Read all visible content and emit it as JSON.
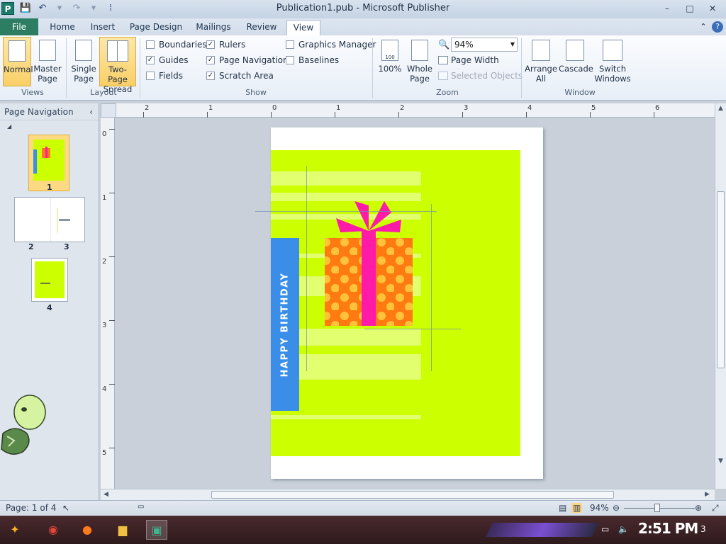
{
  "window": {
    "title": "Publication1.pub - Microsoft Publisher",
    "app_icon_letter": "P",
    "controls": {
      "minimize": "–",
      "maximize": "□",
      "close": "✕"
    }
  },
  "tabs": [
    {
      "label": "File"
    },
    {
      "label": "Home"
    },
    {
      "label": "Insert"
    },
    {
      "label": "Page Design"
    },
    {
      "label": "Mailings"
    },
    {
      "label": "Review"
    },
    {
      "label": "View",
      "active": true
    }
  ],
  "ribbon": {
    "views": {
      "label": "Views",
      "normal": "Normal",
      "master": "Master Page"
    },
    "layout": {
      "label": "Layout",
      "single": "Single Page",
      "two_page": "Two-Page Spread"
    },
    "show": {
      "label": "Show",
      "boundaries": {
        "label": "Boundaries",
        "checked": false
      },
      "guides": {
        "label": "Guides",
        "checked": true
      },
      "fields": {
        "label": "Fields",
        "checked": false
      },
      "rulers": {
        "label": "Rulers",
        "checked": true
      },
      "page_navigation": {
        "label": "Page Navigation",
        "checked": true
      },
      "scratch_area": {
        "label": "Scratch Area",
        "checked": true
      },
      "graphics_manager": {
        "label": "Graphics Manager",
        "checked": false
      },
      "baselines": {
        "label": "Baselines",
        "checked": false
      }
    },
    "zoom": {
      "label": "Zoom",
      "hundred": "100%",
      "whole_page": "Whole Page",
      "value": "94%",
      "page_width": "Page Width",
      "selected_objects": "Selected Objects",
      "hundred_icon_text": "100"
    },
    "window": {
      "label": "Window",
      "arrange_all": "Arrange All",
      "cascade": "Cascade",
      "switch_windows": "Switch Windows"
    }
  },
  "nav_pane": {
    "title": "Page Navigation",
    "collapse": "‹",
    "pages": [
      {
        "label": "1",
        "selected": true
      },
      {
        "label": "2"
      },
      {
        "label": "3"
      },
      {
        "label": "4"
      }
    ]
  },
  "rulers": {
    "horizontal": [
      "2",
      "1",
      "0",
      "1",
      "2",
      "3",
      "4",
      "5",
      "6"
    ],
    "vertical": [
      "0",
      "1",
      "2",
      "3",
      "4",
      "5"
    ]
  },
  "card": {
    "text": "HAPPY BIRTHDAY",
    "colors": {
      "background": "#ccff00",
      "band": "#3a8ee8",
      "box": "#ff7a10",
      "dots": "#ffc23a",
      "ribbon": "#ff1aa8"
    }
  },
  "status": {
    "page": "Page: 1 of 4",
    "zoom": "94%",
    "zoom_level": 0.47
  },
  "taskbar": {
    "time": "2:51 PM",
    "notifications": "3"
  }
}
